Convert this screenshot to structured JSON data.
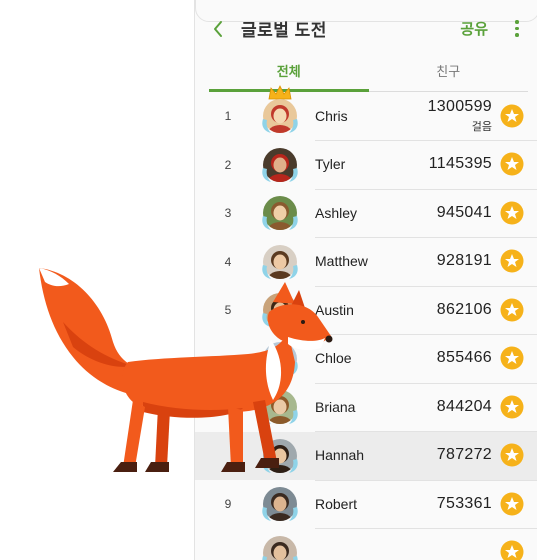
{
  "header": {
    "back_icon": "chevron-left-icon",
    "title": "글로벌 도전",
    "share_label": "공유",
    "more_icon": "more-vertical-icon"
  },
  "tabs": [
    {
      "label": "전체",
      "active": true
    },
    {
      "label": "친구",
      "active": false
    }
  ],
  "colors": {
    "accent": "#5aa13a",
    "badge": "#f6b21a",
    "fox": "#f25a1c"
  },
  "leaderboard": [
    {
      "rank": "1",
      "name": "Chris",
      "score": "1300599",
      "unit": "걸음"
    },
    {
      "rank": "2",
      "name": "Tyler",
      "score": "1145395"
    },
    {
      "rank": "3",
      "name": "Ashley",
      "score": "945041"
    },
    {
      "rank": "4",
      "name": "Matthew",
      "score": "928191"
    },
    {
      "rank": "5",
      "name": "Austin",
      "score": "862106"
    },
    {
      "rank": "",
      "name": "Chloe",
      "score": "855466"
    },
    {
      "rank": "",
      "name": "Briana",
      "score": "844204"
    },
    {
      "rank": "",
      "name": "Hannah",
      "score": "787272"
    },
    {
      "rank": "9",
      "name": "Robert",
      "score": "753361"
    },
    {
      "rank": "",
      "name": "",
      "score": ""
    }
  ]
}
